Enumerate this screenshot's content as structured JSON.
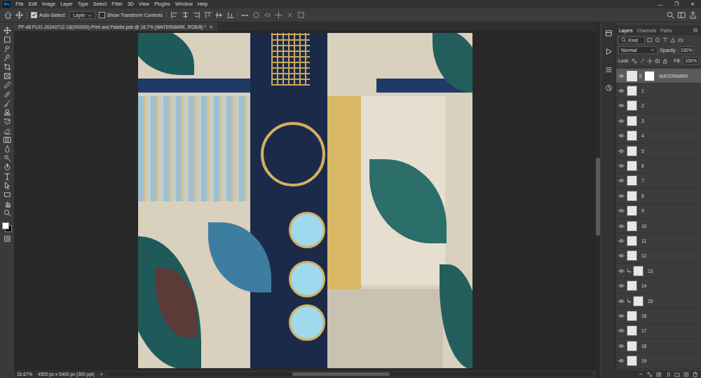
{
  "app": {
    "logo": "Ps"
  },
  "menu": [
    "File",
    "Edit",
    "Image",
    "Layer",
    "Type",
    "Select",
    "Filter",
    "3D",
    "View",
    "Plugins",
    "Window",
    "Help"
  ],
  "window_controls": [
    "—",
    "❐",
    "✕"
  ],
  "options_bar": {
    "auto_select": {
      "label": "Auto-Select:",
      "checked": true
    },
    "target": "Layer",
    "transform_controls": {
      "label": "Show Transform Controls",
      "checked": false
    },
    "more": "•••"
  },
  "document": {
    "tab_title": "PP-48 PL01-20240712-18(000000)-Print and Palette.psb @ 16.7% (WATERMARK, RGB/8) *",
    "close": "×"
  },
  "layers_panel": {
    "tabs": [
      {
        "label": "Layers",
        "selected": true
      },
      {
        "label": "Channels",
        "selected": false
      },
      {
        "label": "Paths",
        "selected": false
      }
    ],
    "filter": "Kind",
    "blend_mode": "Normal",
    "opacity_label": "Opacity:",
    "opacity": "100%",
    "lock_label": "Lock:",
    "fill_label": "Fill:",
    "fill": "100%",
    "layers": [
      {
        "name": "WATERMARK",
        "visible": true,
        "selected": true,
        "clipped": false,
        "has_mask": true
      },
      {
        "name": "1",
        "visible": true,
        "selected": false,
        "clipped": false,
        "has_mask": false
      },
      {
        "name": "2",
        "visible": true,
        "selected": false,
        "clipped": false,
        "has_mask": false
      },
      {
        "name": "3",
        "visible": true,
        "selected": false,
        "clipped": false,
        "has_mask": false
      },
      {
        "name": "4",
        "visible": true,
        "selected": false,
        "clipped": false,
        "has_mask": false
      },
      {
        "name": "5",
        "visible": true,
        "selected": false,
        "clipped": false,
        "has_mask": false
      },
      {
        "name": "6",
        "visible": true,
        "selected": false,
        "clipped": false,
        "has_mask": false
      },
      {
        "name": "7",
        "visible": true,
        "selected": false,
        "clipped": false,
        "has_mask": false
      },
      {
        "name": "8",
        "visible": true,
        "selected": false,
        "clipped": false,
        "has_mask": false
      },
      {
        "name": "9",
        "visible": true,
        "selected": false,
        "clipped": false,
        "has_mask": false
      },
      {
        "name": "10",
        "visible": true,
        "selected": false,
        "clipped": false,
        "has_mask": false
      },
      {
        "name": "11",
        "visible": true,
        "selected": false,
        "clipped": false,
        "has_mask": false
      },
      {
        "name": "12",
        "visible": true,
        "selected": false,
        "clipped": false,
        "has_mask": false
      },
      {
        "name": "13",
        "visible": true,
        "selected": false,
        "clipped": true,
        "has_mask": false
      },
      {
        "name": "14",
        "visible": true,
        "selected": false,
        "clipped": false,
        "has_mask": false
      },
      {
        "name": "15",
        "visible": true,
        "selected": false,
        "clipped": true,
        "has_mask": false
      },
      {
        "name": "16",
        "visible": true,
        "selected": false,
        "clipped": false,
        "has_mask": false
      },
      {
        "name": "17",
        "visible": true,
        "selected": false,
        "clipped": false,
        "has_mask": false
      },
      {
        "name": "18",
        "visible": true,
        "selected": false,
        "clipped": false,
        "has_mask": false
      },
      {
        "name": "19",
        "visible": true,
        "selected": false,
        "clipped": false,
        "has_mask": false
      }
    ]
  },
  "status_bar": {
    "zoom": "16.67%",
    "info": "4500 px x 5400 px (300 ppi)",
    "arrow": ">"
  }
}
